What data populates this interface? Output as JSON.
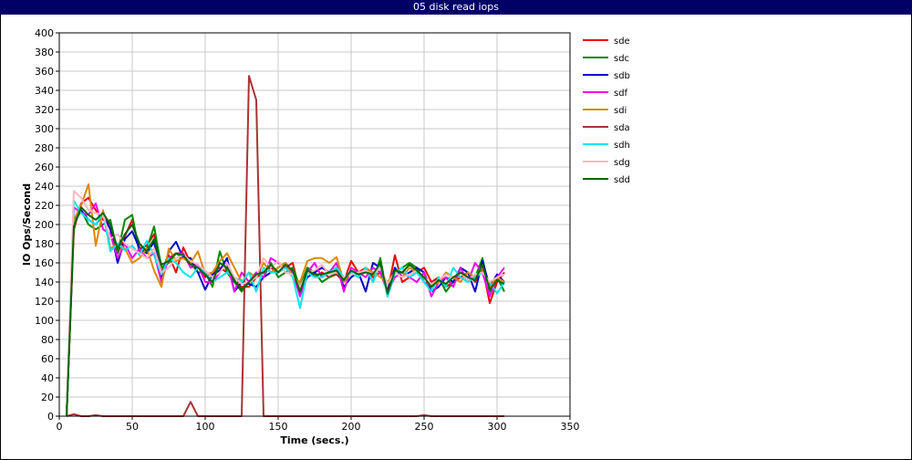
{
  "window": {
    "title": "05 disk read iops"
  },
  "chart_data": {
    "type": "line",
    "title": "05 disk read iops",
    "xlabel": "Time (secs.)",
    "ylabel": "IO Ops/Second",
    "xlim": [
      0,
      350
    ],
    "ylim": [
      0,
      400
    ],
    "xticks": [
      0,
      50,
      100,
      150,
      200,
      250,
      300,
      350
    ],
    "yticks": [
      0,
      20,
      40,
      60,
      80,
      100,
      120,
      140,
      160,
      180,
      200,
      220,
      240,
      260,
      280,
      300,
      320,
      340,
      360,
      380,
      400
    ],
    "grid": true,
    "legend_position": "right",
    "x": [
      5,
      10,
      15,
      20,
      25,
      30,
      35,
      40,
      45,
      50,
      55,
      60,
      65,
      70,
      75,
      80,
      85,
      90,
      95,
      100,
      105,
      110,
      115,
      120,
      125,
      130,
      135,
      140,
      145,
      150,
      155,
      160,
      165,
      170,
      175,
      180,
      185,
      190,
      195,
      200,
      205,
      210,
      215,
      220,
      225,
      230,
      235,
      240,
      245,
      250,
      255,
      260,
      265,
      270,
      275,
      280,
      285,
      290,
      295,
      300,
      305
    ],
    "series": [
      {
        "name": "sde",
        "color": "#ee0000",
        "values": [
          0,
          195,
          222,
          228,
          215,
          205,
          200,
          170,
          188,
          205,
          175,
          178,
          190,
          150,
          168,
          150,
          176,
          160,
          158,
          145,
          150,
          155,
          150,
          140,
          135,
          135,
          145,
          150,
          155,
          150,
          155,
          160,
          128,
          155,
          145,
          150,
          145,
          148,
          140,
          162,
          150,
          155,
          145,
          150,
          130,
          168,
          140,
          145,
          150,
          155,
          140,
          145,
          135,
          140,
          145,
          150,
          140,
          155,
          118,
          140,
          150
        ]
      },
      {
        "name": "sdc",
        "color": "#008800",
        "values": [
          0,
          200,
          215,
          200,
          195,
          200,
          205,
          170,
          205,
          210,
          170,
          175,
          198,
          155,
          160,
          170,
          165,
          160,
          150,
          150,
          135,
          172,
          150,
          140,
          130,
          140,
          150,
          145,
          160,
          145,
          150,
          155,
          135,
          155,
          150,
          140,
          145,
          150,
          140,
          150,
          145,
          155,
          140,
          165,
          125,
          150,
          155,
          160,
          155,
          140,
          135,
          145,
          130,
          140,
          150,
          145,
          145,
          165,
          130,
          145,
          130
        ]
      },
      {
        "name": "sdb",
        "color": "#0000cc",
        "values": [
          0,
          205,
          215,
          205,
          200,
          210,
          195,
          160,
          185,
          193,
          175,
          170,
          182,
          145,
          172,
          182,
          165,
          165,
          150,
          132,
          148,
          152,
          165,
          130,
          140,
          138,
          135,
          145,
          150,
          155,
          160,
          150,
          130,
          145,
          150,
          155,
          150,
          155,
          135,
          145,
          150,
          130,
          160,
          155,
          130,
          155,
          145,
          150,
          155,
          150,
          130,
          135,
          145,
          140,
          155,
          150,
          130,
          162,
          135,
          148,
          140
        ]
      },
      {
        "name": "sdf",
        "color": "#ee00ee",
        "values": [
          0,
          218,
          212,
          210,
          222,
          195,
          190,
          165,
          180,
          165,
          175,
          165,
          170,
          140,
          165,
          170,
          170,
          155,
          158,
          140,
          140,
          150,
          160,
          130,
          150,
          140,
          150,
          145,
          165,
          160,
          155,
          150,
          125,
          150,
          160,
          145,
          150,
          160,
          130,
          155,
          150,
          145,
          155,
          150,
          130,
          145,
          150,
          145,
          140,
          150,
          125,
          140,
          145,
          135,
          155,
          140,
          160,
          150,
          125,
          145,
          155
        ]
      },
      {
        "name": "sdi",
        "color": "#dd8800",
        "values": [
          0,
          205,
          220,
          242,
          178,
          215,
          175,
          180,
          175,
          160,
          165,
          175,
          152,
          135,
          175,
          162,
          165,
          160,
          172,
          148,
          150,
          162,
          170,
          155,
          140,
          150,
          145,
          160,
          150,
          155,
          160,
          145,
          140,
          162,
          165,
          165,
          160,
          166,
          140,
          150,
          145,
          155,
          150,
          145,
          140,
          150,
          145,
          155,
          150,
          145,
          135,
          140,
          150,
          145,
          140,
          150,
          145,
          155,
          135,
          145,
          140
        ]
      },
      {
        "name": "sda",
        "color": "#aa3333",
        "values": [
          0,
          2,
          0,
          0,
          1,
          0,
          0,
          0,
          0,
          0,
          0,
          0,
          0,
          0,
          0,
          0,
          0,
          15,
          0,
          0,
          0,
          0,
          0,
          0,
          0,
          355,
          330,
          0,
          0,
          0,
          0,
          0,
          0,
          0,
          0,
          0,
          0,
          0,
          0,
          0,
          0,
          0,
          0,
          0,
          0,
          0,
          0,
          0,
          0,
          1,
          0,
          0,
          0,
          0,
          0,
          0,
          0,
          0,
          0,
          0,
          0
        ]
      },
      {
        "name": "sdh",
        "color": "#00e5ee",
        "values": [
          0,
          225,
          212,
          205,
          200,
          212,
          172,
          180,
          173,
          178,
          168,
          183,
          168,
          148,
          165,
          160,
          150,
          145,
          155,
          150,
          140,
          145,
          150,
          145,
          140,
          150,
          130,
          155,
          150,
          150,
          155,
          145,
          113,
          150,
          145,
          145,
          150,
          155,
          145,
          150,
          145,
          155,
          140,
          160,
          125,
          150,
          155,
          145,
          150,
          140,
          130,
          145,
          135,
          155,
          145,
          140,
          145,
          150,
          140,
          128,
          140
        ]
      },
      {
        "name": "sdg",
        "color": "#ffb6c1",
        "values": [
          0,
          235,
          228,
          215,
          212,
          210,
          185,
          190,
          180,
          175,
          170,
          165,
          175,
          150,
          155,
          165,
          168,
          162,
          158,
          152,
          145,
          150,
          160,
          145,
          138,
          140,
          145,
          165,
          155,
          162,
          150,
          148,
          135,
          150,
          152,
          158,
          148,
          150,
          145,
          148,
          150,
          152,
          148,
          155,
          138,
          150,
          145,
          148,
          152,
          145,
          138,
          142,
          148,
          145,
          150,
          142,
          148,
          150,
          140,
          145,
          148
        ]
      },
      {
        "name": "sdd",
        "color": "#006600",
        "values": [
          0,
          198,
          218,
          210,
          205,
          212,
          200,
          175,
          190,
          200,
          180,
          172,
          185,
          158,
          162,
          170,
          168,
          158,
          155,
          148,
          140,
          160,
          155,
          142,
          132,
          140,
          148,
          150,
          158,
          150,
          158,
          152,
          130,
          152,
          148,
          148,
          150,
          152,
          142,
          152,
          148,
          150,
          148,
          160,
          128,
          152,
          150,
          158,
          152,
          145,
          135,
          142,
          138,
          145,
          150,
          145,
          142,
          158,
          132,
          142,
          138
        ]
      }
    ]
  }
}
